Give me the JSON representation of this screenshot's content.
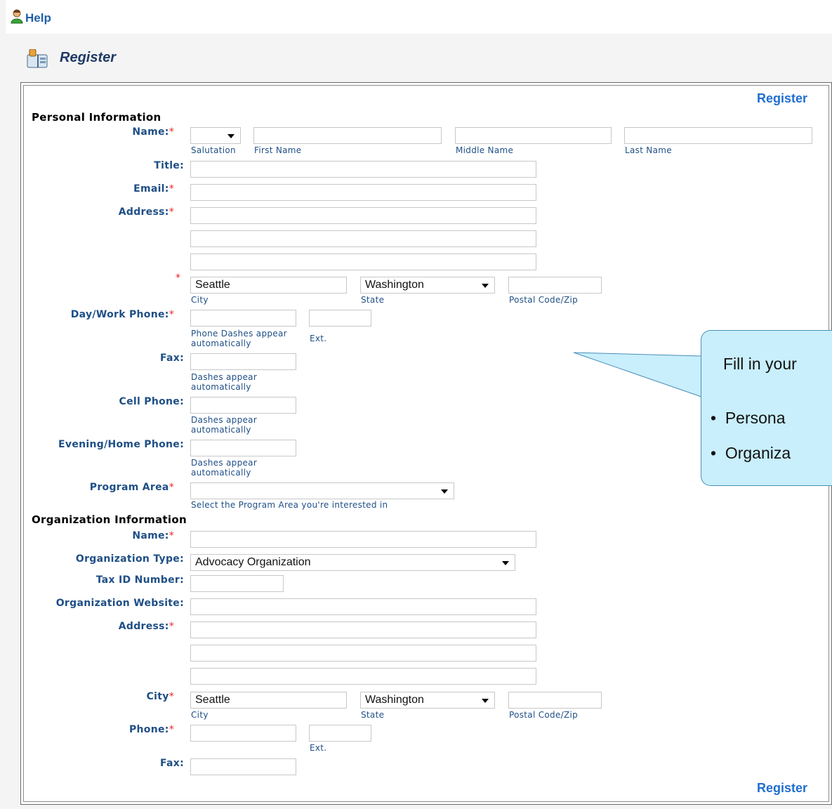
{
  "topbar": {
    "help_label": "Help"
  },
  "header": {
    "title": "Register"
  },
  "actions": {
    "register_top": "Register",
    "register_bottom": "Register"
  },
  "personal": {
    "section_title": "Personal Information",
    "name_label": "Name:",
    "salutation_hint": "Salutation",
    "first_name_hint": "First Name",
    "middle_name_hint": "Middle Name",
    "last_name_hint": "Last Name",
    "title_label": "Title:",
    "email_label": "Email:",
    "address_label": "Address:",
    "city_value": "Seattle",
    "state_value": "Washington",
    "city_hint": "City",
    "state_hint": "State",
    "postal_hint": "Postal Code/Zip",
    "day_phone_label": "Day/Work Phone:",
    "day_phone_hint_1": "Phone Dashes appear",
    "day_phone_hint_2": "automatically",
    "ext_hint": "Ext.",
    "fax_label": "Fax:",
    "dashes_hint_1": "Dashes appear",
    "dashes_hint_2": "automatically",
    "cell_label": "Cell Phone:",
    "evening_label": "Evening/Home Phone:",
    "program_area_label": "Program Area",
    "program_area_hint": "Select the Program Area you're interested in"
  },
  "organization": {
    "section_title": "Organization Information",
    "name_label": "Name:",
    "type_label": "Organization Type:",
    "type_value": "Advocacy Organization",
    "tax_label": "Tax ID Number:",
    "website_label": "Organization Website:",
    "address_label": "Address:",
    "city_label": "City",
    "city_value": "Seattle",
    "state_value": "Washington",
    "city_hint": "City",
    "state_hint": "State",
    "postal_hint": "Postal Code/Zip",
    "phone_label": "Phone:",
    "ext_hint": "Ext.",
    "fax_label": "Fax:"
  },
  "callout": {
    "line1": "Fill in your",
    "bullet1": "Persona",
    "bullet2": "Organiza"
  },
  "colors": {
    "label": "#1f4f86",
    "required": "#ee2222",
    "link": "#1f6fd0",
    "callout_bg": "#c9eefc"
  },
  "icons": {
    "help": "person-help-icon",
    "register": "book-icon",
    "dropdown": "chevron-down-icon"
  }
}
